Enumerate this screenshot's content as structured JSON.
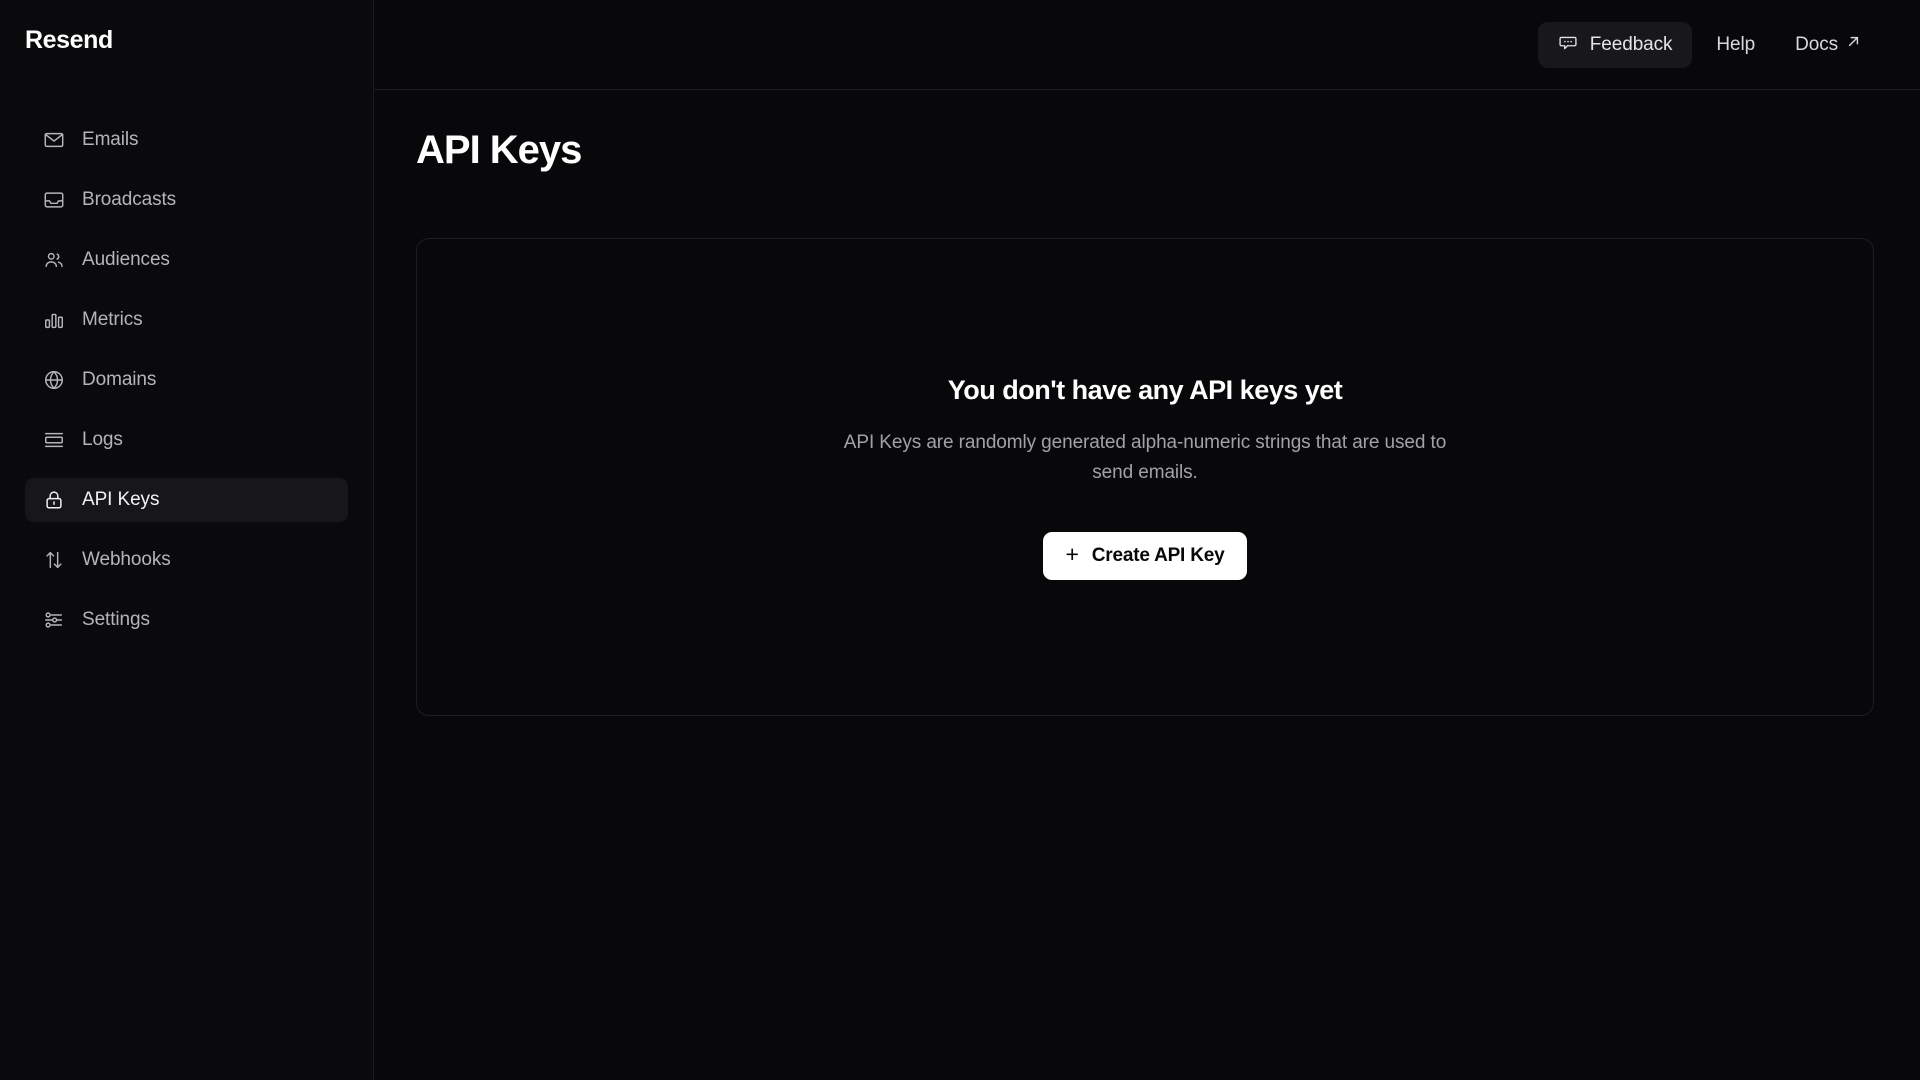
{
  "brand": {
    "name": "Resend"
  },
  "sidebar": {
    "items": [
      {
        "label": "Emails",
        "icon": "envelope-icon",
        "active": false
      },
      {
        "label": "Broadcasts",
        "icon": "inbox-icon",
        "active": false
      },
      {
        "label": "Audiences",
        "icon": "users-icon",
        "active": false
      },
      {
        "label": "Metrics",
        "icon": "bar-chart-icon",
        "active": false
      },
      {
        "label": "Domains",
        "icon": "globe-icon",
        "active": false
      },
      {
        "label": "Logs",
        "icon": "logs-icon",
        "active": false
      },
      {
        "label": "API Keys",
        "icon": "lock-icon",
        "active": true
      },
      {
        "label": "Webhooks",
        "icon": "arrows-updown-icon",
        "active": false
      },
      {
        "label": "Settings",
        "icon": "sliders-icon",
        "active": false
      }
    ]
  },
  "topbar": {
    "feedback_label": "Feedback",
    "feedback_icon": "message-dots-icon",
    "help_label": "Help",
    "docs_label": "Docs",
    "docs_icon": "external-link-arrow-icon"
  },
  "page": {
    "title": "API Keys"
  },
  "empty_state": {
    "title": "You don't have any API keys yet",
    "description": "API Keys are randomly generated alpha-numeric strings that are used to send emails.",
    "button_label": "Create API Key",
    "button_icon": "plus-icon"
  },
  "colors": {
    "background": "#08080a",
    "sidebar_bg": "#0a0a0c",
    "border": "#1c1c20",
    "active_item_bg": "#17171a",
    "text_primary": "#ffffff",
    "text_muted": "#a1a1aa",
    "button_bg": "#ffffff",
    "button_text": "#08080a"
  }
}
